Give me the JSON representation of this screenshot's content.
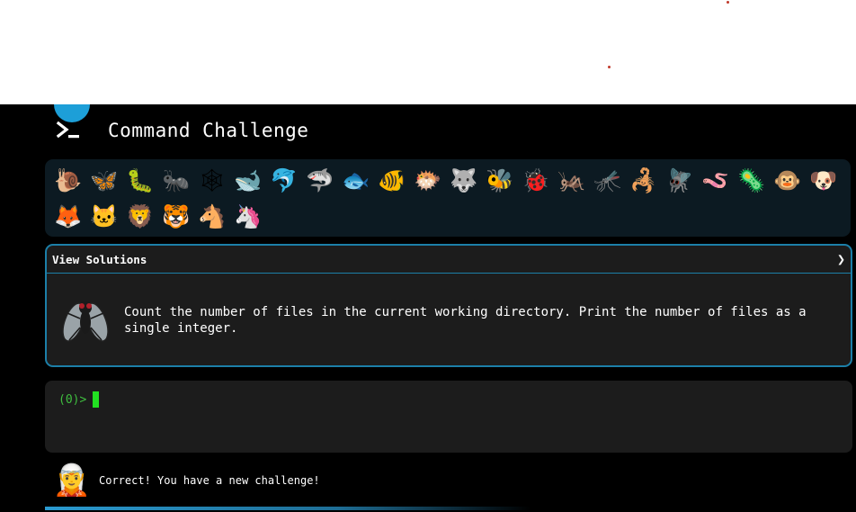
{
  "app": {
    "title": "Command Challenge",
    "logo_icon": "terminal-prompt-icon",
    "accent_color": "#1d9fd8"
  },
  "challenges": {
    "emojis": [
      {
        "name": "snail",
        "glyph": "🐌"
      },
      {
        "name": "butterfly",
        "glyph": "🦋"
      },
      {
        "name": "caterpillar",
        "glyph": "🐛"
      },
      {
        "name": "ant",
        "glyph": "🐜"
      },
      {
        "name": "spider-web",
        "glyph": "🕸"
      },
      {
        "name": "whale",
        "glyph": "🐋"
      },
      {
        "name": "dolphin",
        "glyph": "🐬"
      },
      {
        "name": "shark",
        "glyph": "🦈"
      },
      {
        "name": "fish",
        "glyph": "🐟"
      },
      {
        "name": "tropical-fish",
        "glyph": "🐠"
      },
      {
        "name": "blowfish",
        "glyph": "🐡"
      },
      {
        "name": "wolf",
        "glyph": "🐺"
      },
      {
        "name": "bee",
        "glyph": "🐝"
      },
      {
        "name": "ladybug",
        "glyph": "🐞"
      },
      {
        "name": "cricket",
        "glyph": "🦗"
      },
      {
        "name": "mosquito",
        "glyph": "🦟"
      },
      {
        "name": "scorpion",
        "glyph": "🦂"
      },
      {
        "name": "fly",
        "glyph": "🪰"
      },
      {
        "name": "worm",
        "glyph": "🪱"
      },
      {
        "name": "microbe",
        "glyph": "🦠"
      },
      {
        "name": "monkey",
        "glyph": "🐵"
      },
      {
        "name": "dog",
        "glyph": "🐶"
      },
      {
        "name": "fox",
        "glyph": "🦊"
      },
      {
        "name": "cat",
        "glyph": "🐱"
      },
      {
        "name": "lion",
        "glyph": "🦁"
      },
      {
        "name": "tiger",
        "glyph": "🐯"
      },
      {
        "name": "horse",
        "glyph": "🐴"
      },
      {
        "name": "unicorn",
        "glyph": "🦄"
      }
    ]
  },
  "current_challenge": {
    "header": "View Solutions",
    "chevron": "❯",
    "icon": "fly-icon",
    "description": "Count the number of files in the current working directory. Print the number of files as a single integer."
  },
  "terminal": {
    "prompt": "(0)>"
  },
  "status": {
    "emoji": "🧝",
    "message": "Correct! You have a new challenge!"
  }
}
